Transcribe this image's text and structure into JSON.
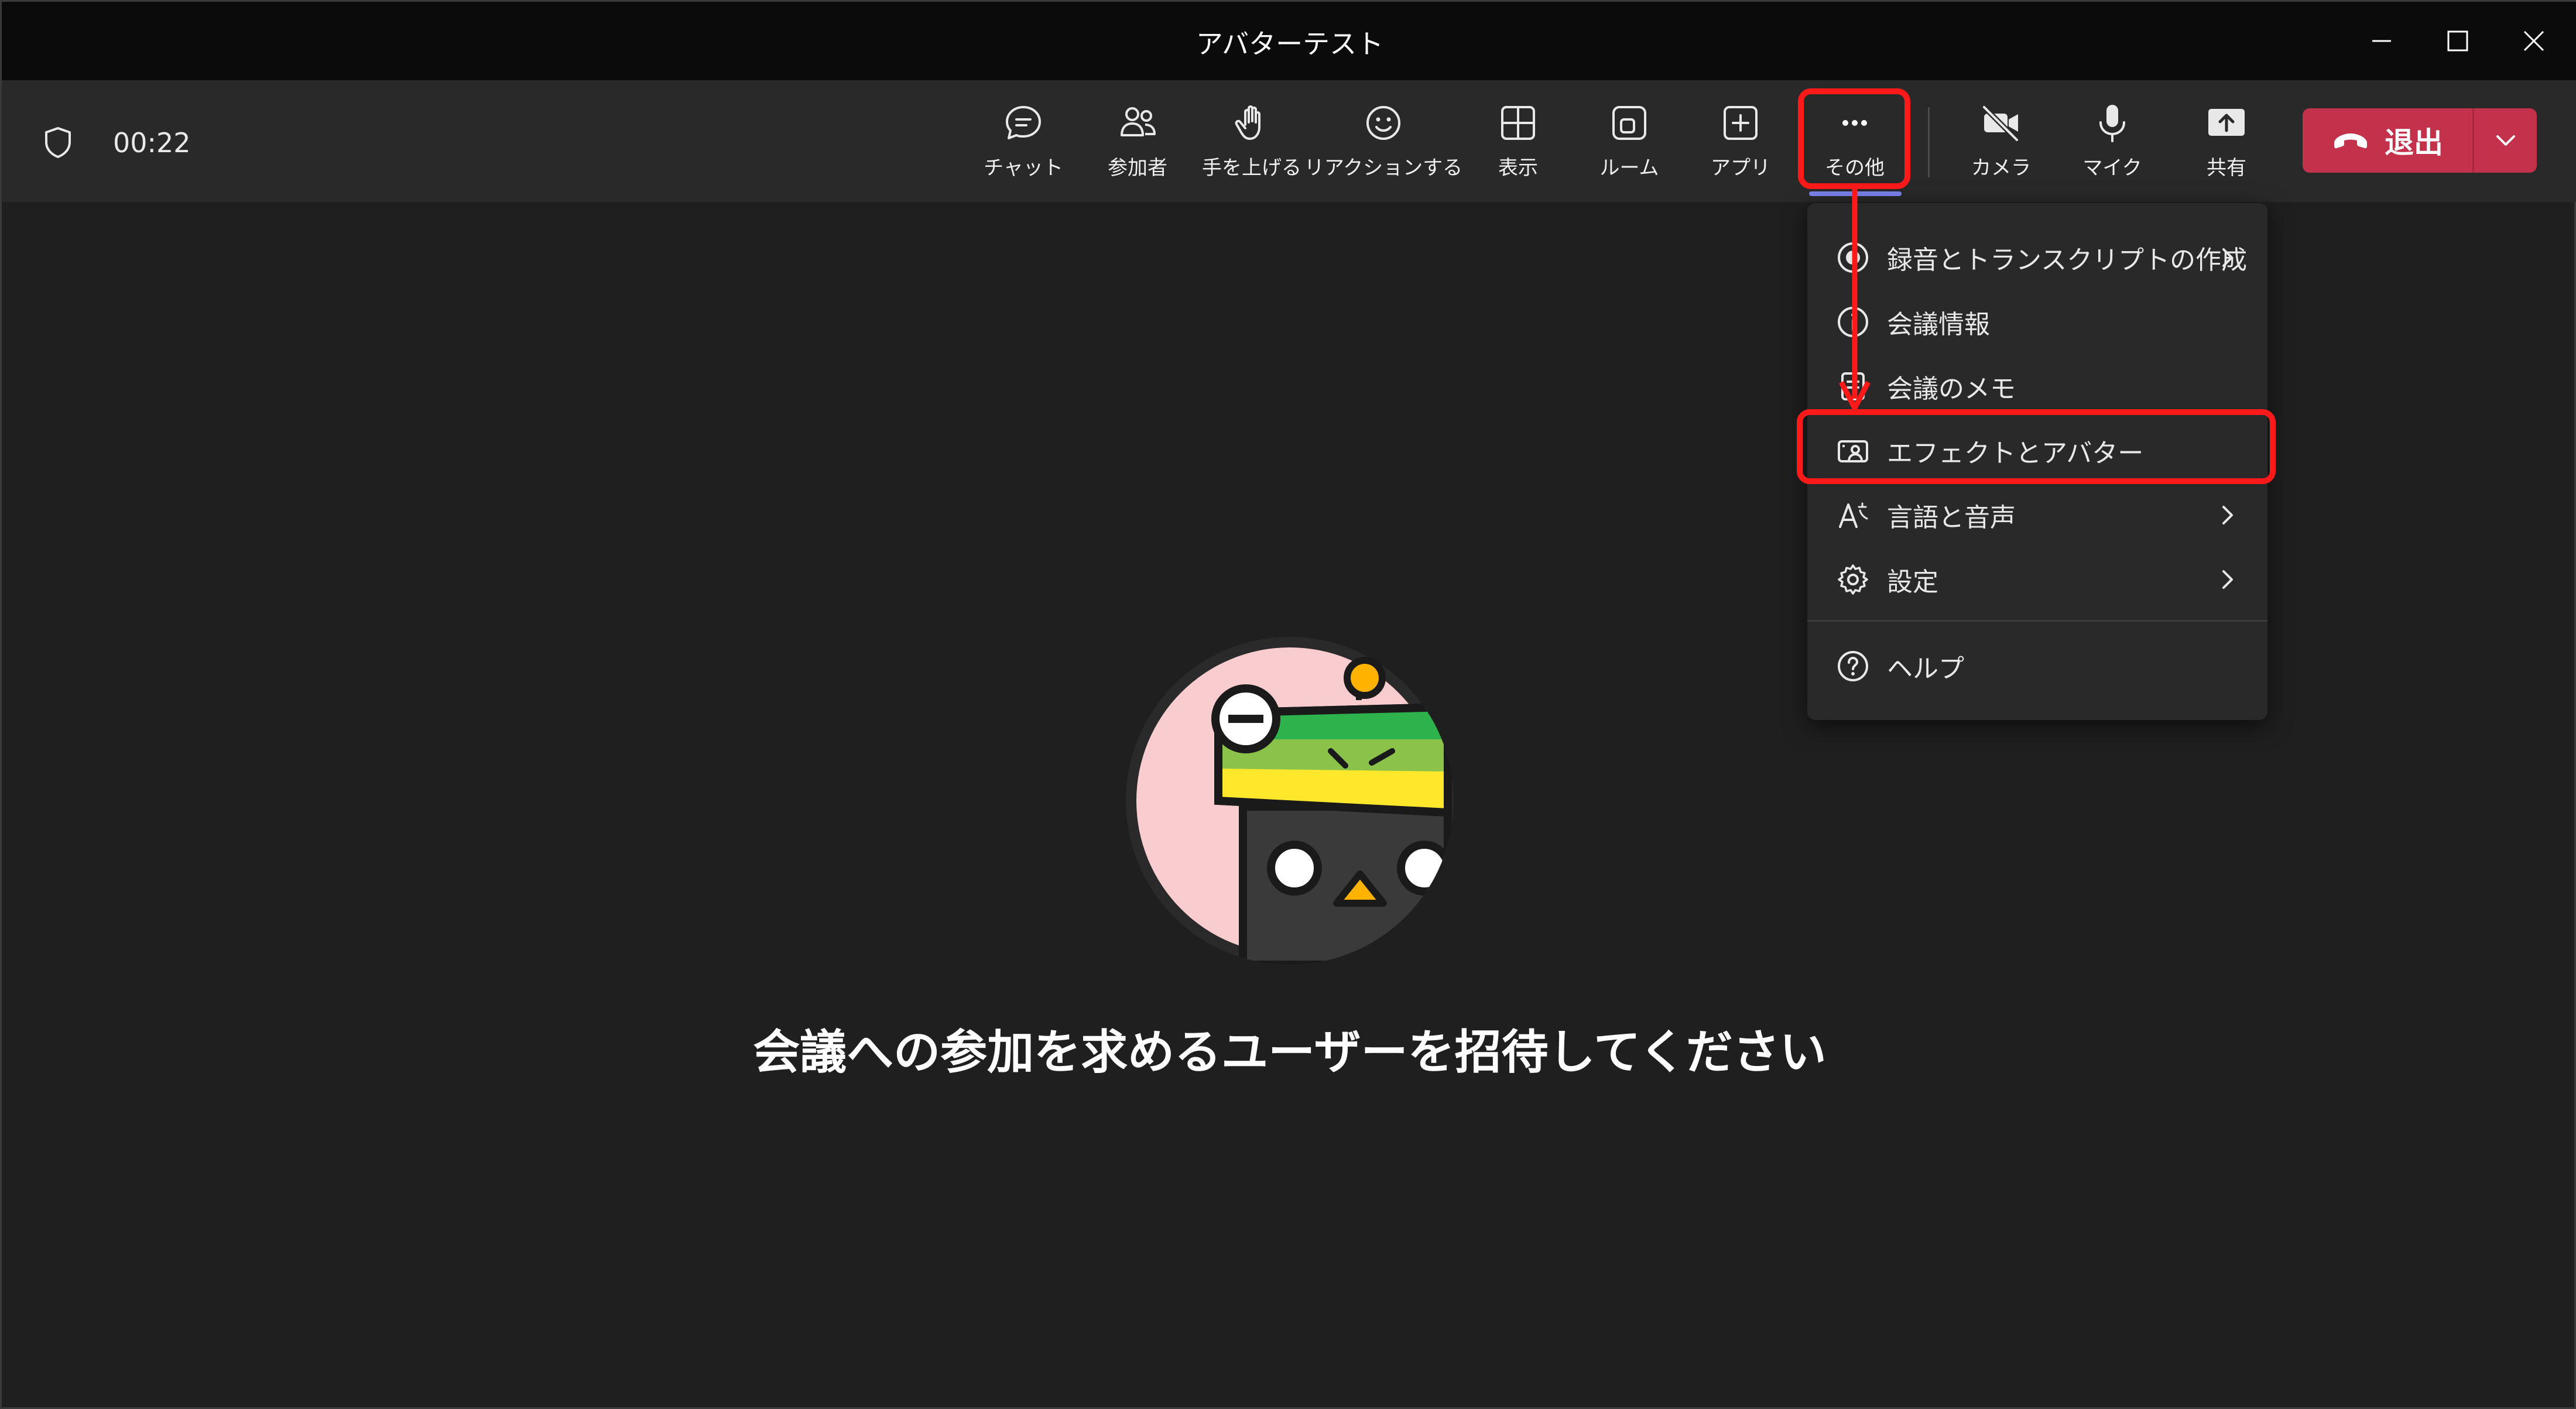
{
  "window": {
    "title": "アバターテスト"
  },
  "call": {
    "timer": "00:22"
  },
  "toolbar": {
    "buttons": [
      {
        "label": "チャット",
        "icon": "chat-icon"
      },
      {
        "label": "参加者",
        "icon": "people-icon"
      },
      {
        "label": "手を上げる",
        "icon": "raise-hand-icon"
      },
      {
        "label": "リアクションする",
        "icon": "smile-icon"
      },
      {
        "label": "表示",
        "icon": "grid-icon"
      },
      {
        "label": "ルーム",
        "icon": "rooms-icon"
      },
      {
        "label": "アプリ",
        "icon": "add-app-icon"
      },
      {
        "label": "その他",
        "icon": "more-icon"
      },
      {
        "label": "カメラ",
        "icon": "camera-off-icon"
      },
      {
        "label": "マイク",
        "icon": "microphone-icon"
      },
      {
        "label": "共有",
        "icon": "share-icon"
      }
    ],
    "leave_label": "退出"
  },
  "more_menu": {
    "items": [
      {
        "label": "録音とトランスクリプトの作成",
        "icon": "record-icon"
      },
      {
        "label": "会議情報",
        "icon": "info-icon"
      },
      {
        "label": "会議のメモ",
        "icon": "notes-icon"
      },
      {
        "label": "エフェクトとアバター",
        "icon": "effects-avatar-icon"
      },
      {
        "label": "言語と音声",
        "icon": "language-icon"
      },
      {
        "label": "設定",
        "icon": "gear-icon"
      },
      {
        "label": "ヘルプ",
        "icon": "help-icon"
      }
    ]
  },
  "main": {
    "invite_text": "会議への参加を求めるユーザーを招待してください"
  },
  "colors": {
    "leave": "#c4314b",
    "highlight": "#ff1a1a",
    "active_underline": "#7b83eb"
  }
}
